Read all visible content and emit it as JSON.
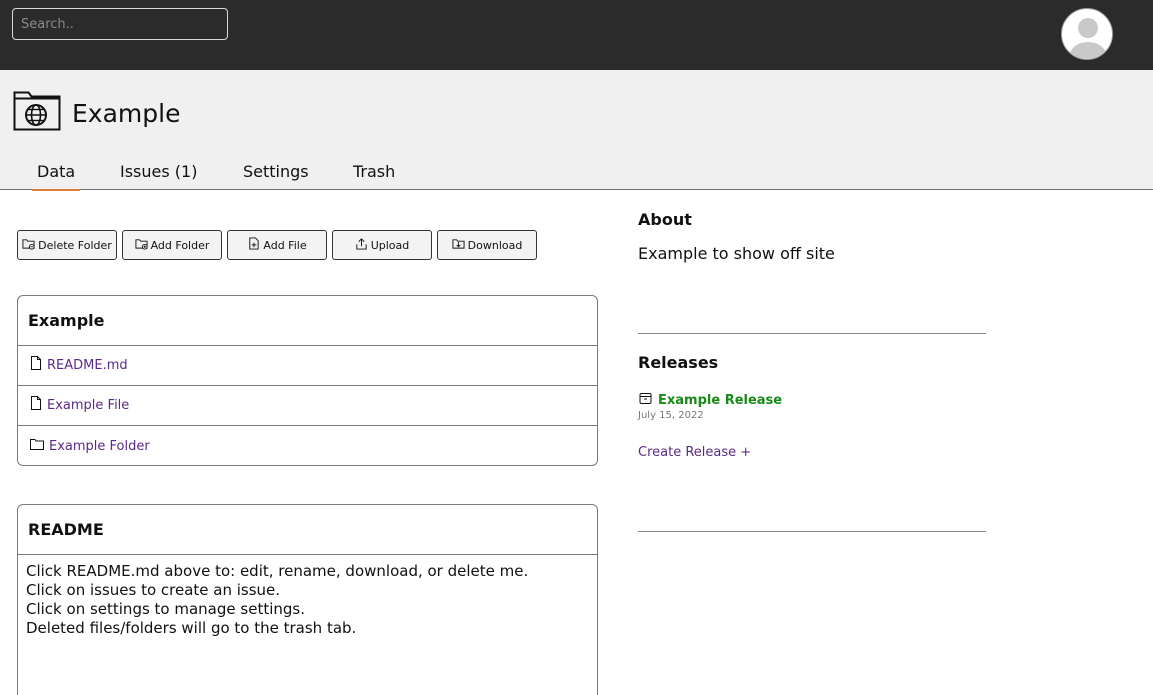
{
  "search": {
    "placeholder": "Search.."
  },
  "repo": {
    "title": "Example"
  },
  "tabs": [
    {
      "label": "Data"
    },
    {
      "label": "Issues (1)"
    },
    {
      "label": "Settings"
    },
    {
      "label": "Trash"
    }
  ],
  "toolbar": {
    "delete_folder": "Delete Folder",
    "add_folder": "Add Folder",
    "add_file": "Add File",
    "upload": "Upload",
    "download": "Download"
  },
  "files": {
    "title": "Example",
    "items": [
      {
        "name": "README.md",
        "icon": "file-icon"
      },
      {
        "name": "Example File",
        "icon": "file-icon"
      },
      {
        "name": "Example Folder",
        "icon": "folder-icon"
      }
    ]
  },
  "readme": {
    "title": "README",
    "lines": [
      "Click README.md above to: edit, rename, download, or delete me.",
      "Click on issues to create an issue.",
      "Click on settings to manage settings.",
      "Deleted files/folders will go to the trash tab."
    ]
  },
  "about": {
    "heading": "About",
    "description": "Example to show off site"
  },
  "releases": {
    "heading": "Releases",
    "items": [
      {
        "name": "Example Release",
        "date": "July 15, 2022"
      }
    ],
    "create_label": "Create Release +"
  },
  "colors": {
    "topbar": "#2b2b2b",
    "header_bg": "#f0f0f0",
    "active_tab_underline": "#e07b39",
    "link": "#5b2a86",
    "release_link": "#1a8a1a"
  }
}
